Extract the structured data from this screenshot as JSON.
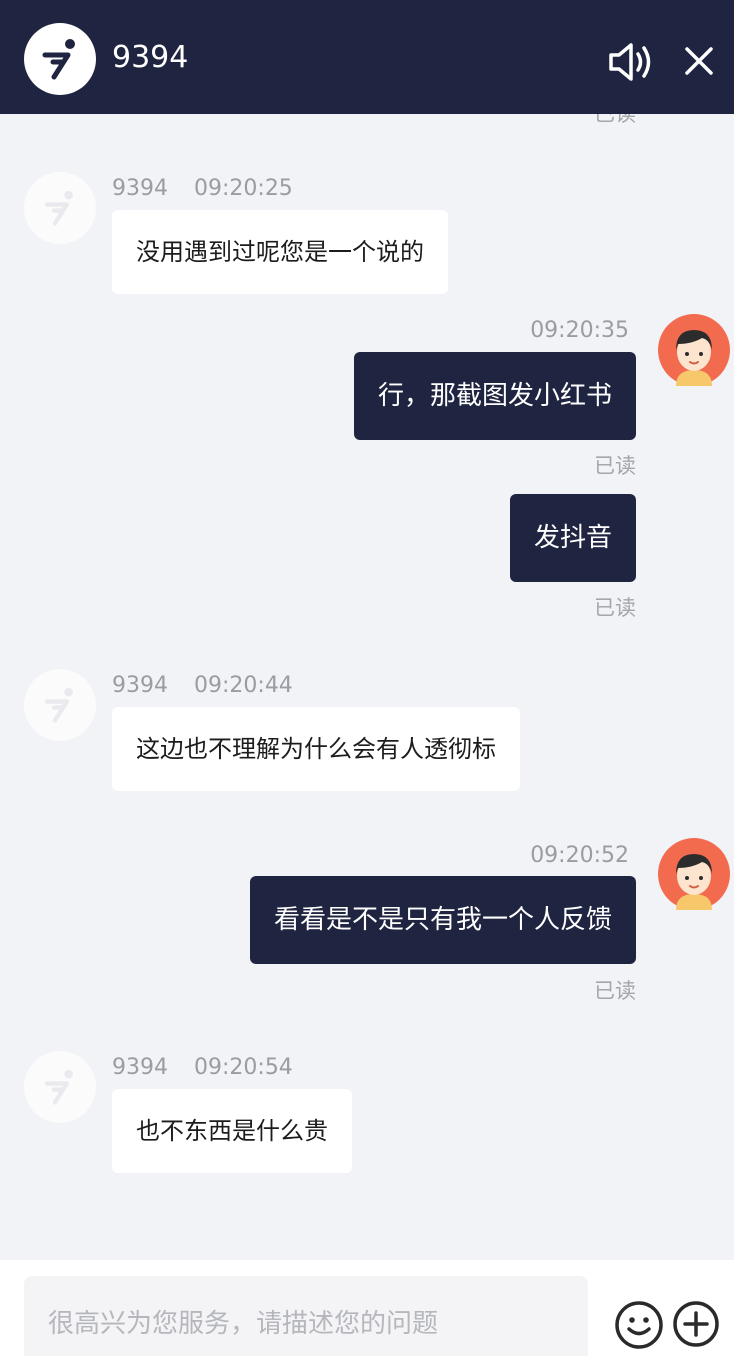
{
  "header": {
    "title": "9394",
    "logo_icon": "scooter-logo-icon",
    "sound_icon": "speaker-icon",
    "close_icon": "close-icon",
    "bg_color": "#1f2440"
  },
  "messages": [
    {
      "side": "out",
      "status": "已读"
    },
    {
      "side": "in",
      "sender": "9394",
      "time": "09:20:25",
      "text": "没用遇到过呢您是一个说的"
    },
    {
      "side": "out",
      "time": "09:20:35",
      "text": "行，那截图发小红书",
      "status": "已读"
    },
    {
      "side": "out",
      "text": "发抖音",
      "status": "已读"
    },
    {
      "side": "in",
      "sender": "9394",
      "time": "09:20:44",
      "text": "这边也不理解为什么会有人透彻标"
    },
    {
      "side": "out",
      "time": "09:20:52",
      "text": "看看是不是只有我一个人反馈",
      "status": "已读"
    },
    {
      "side": "in",
      "sender": "9394",
      "time": "09:20:54",
      "text": "也不东西是什么贵"
    }
  ],
  "composer": {
    "placeholder": "很高兴为您服务，请描述您的问题",
    "emoji_icon": "smiley-icon",
    "plus_icon": "plus-circle-icon"
  }
}
